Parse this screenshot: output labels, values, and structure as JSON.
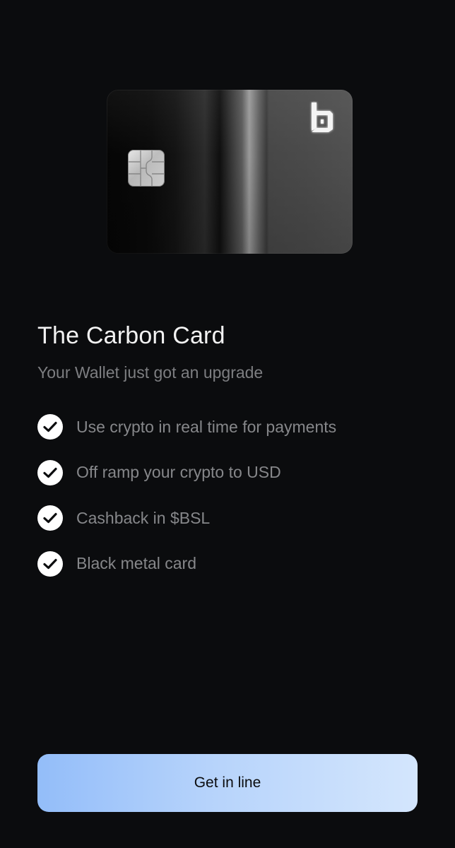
{
  "card": {
    "logo_icon": "carbon-logo-icon",
    "chip_icon": "emv-chip-icon"
  },
  "title": "The Carbon Card",
  "subtitle": "Your Wallet just got an upgrade",
  "features": [
    {
      "icon": "check-circle-icon",
      "label": "Use crypto in real time for payments"
    },
    {
      "icon": "check-circle-icon",
      "label": "Off ramp your crypto to USD"
    },
    {
      "icon": "check-circle-icon",
      "label": "Cashback in $BSL"
    },
    {
      "icon": "check-circle-icon",
      "label": "Black metal card"
    }
  ],
  "cta": {
    "label": "Get in line"
  },
  "colors": {
    "background": "#0b0c0e",
    "title": "#f2f2f2",
    "muted_text": "#7d7e81",
    "button_gradient_start": "#93bdf9",
    "button_gradient_end": "#d4e6fd"
  }
}
